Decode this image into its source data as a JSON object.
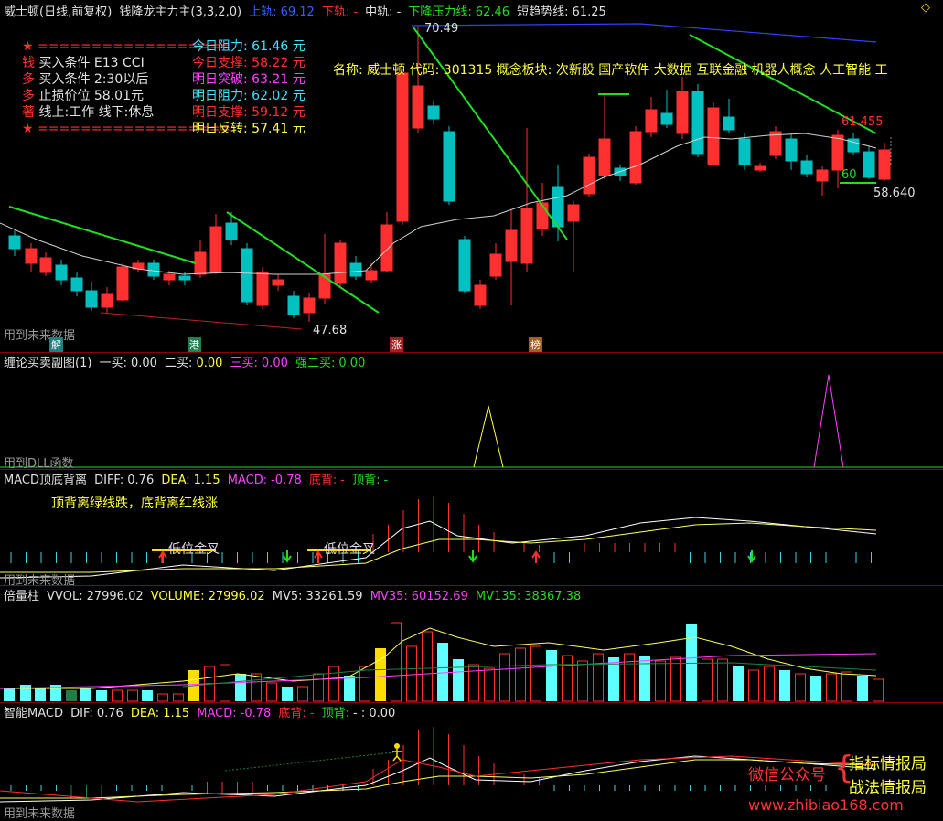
{
  "main": {
    "header": {
      "stock": "威士顿(日线,前复权)",
      "indicator": "钱降龙主力主(3,3,2,0)",
      "upper_label": "上轨:",
      "upper_value": "69.12",
      "lower_label": "下轨:",
      "lower_value": "-",
      "mid_label": "中轨:",
      "mid_value": "-",
      "pressure_label": "下降压力线:",
      "pressure_value": "62.46",
      "trend_label": "短趋势线:",
      "trend_value": "61.25"
    },
    "info_left": [
      {
        "mark": "★",
        "text": "=================="
      },
      {
        "mark": "钱",
        "text": "买入条件 E13 CCI"
      },
      {
        "mark": "多",
        "text": "买入条件 2:30以后"
      },
      {
        "mark": "多",
        "text": "止损价位 58.01元"
      },
      {
        "mark": "著",
        "text": "线上:工作 线下:休息"
      },
      {
        "mark": "★",
        "text": "=================="
      }
    ],
    "info_right": [
      {
        "label": "今日阻力:",
        "value": "61.46 元"
      },
      {
        "label": "今日支撑:",
        "value": "58.22 元"
      },
      {
        "label": "明日突破:",
        "value": "63.21 元"
      },
      {
        "label": "明日阻力:",
        "value": "62.02 元"
      },
      {
        "label": "明日支撑:",
        "value": "59.12 元"
      },
      {
        "label": "明日反转:",
        "value": "57.41 元"
      }
    ],
    "name_line": "名称: 威士顿 代码: 301315 概念板块: 次新股 国产软件 大数据 互联金融 机器人概念 人工智能 工",
    "high_label": "70.49",
    "low_label": "47.68",
    "price_label_1": "61.455",
    "price_label_2": "60",
    "price_label_3": "58.640",
    "future_note": "用到未来数据",
    "bottom_tags": [
      "解",
      "港",
      "涨",
      "榜"
    ]
  },
  "chanlun": {
    "title": "缠论买卖副图(1)",
    "buy1_label": "一买:",
    "buy1_value": "0.00",
    "buy2_label": "二买:",
    "buy2_value": "0.00",
    "buy3_label": "三买:",
    "buy3_value": "0.00",
    "strong2_label": "强二买:",
    "strong2_value": "0.00",
    "note": "用到DLL函数"
  },
  "macd_div": {
    "title": "MACD顶底背离",
    "diff_label": "DIFF:",
    "diff_value": "0.76",
    "dea_label": "DEA:",
    "dea_value": "1.15",
    "macd_label": "MACD:",
    "macd_value": "-0.78",
    "bottom_label": "底背:",
    "bottom_value": "-",
    "top_label": "顶背:",
    "top_value": "-",
    "subtitle": "顶背离绿线跌，底背离红线涨",
    "cross1": "低位金叉",
    "cross2": "低位金叉",
    "note": "用到未来数据"
  },
  "volume": {
    "title": "倍量柱",
    "vvol_label": "VVOL:",
    "vvol_value": "27996.02",
    "volume_label": "VOLUME:",
    "volume_value": "27996.02",
    "mv5_label": "MV5:",
    "mv5_value": "33261.59",
    "mv35_label": "MV35:",
    "mv35_value": "60152.69",
    "mv135_label": "MV135:",
    "mv135_value": "38367.38"
  },
  "smart_macd": {
    "title": "智能MACD",
    "dif_label": "DIF:",
    "dif_value": "0.76",
    "dea_label": "DEA:",
    "dea_value": "1.15",
    "macd_label": "MACD:",
    "macd_value": "-0.78",
    "bottom_label": "底背:",
    "bottom_value": "-",
    "top_label": "顶背:",
    "top_value": "- : 0.00",
    "note": "用到未来数据"
  },
  "watermark": {
    "wechat": "微信公众号",
    "line1": "指标情报局",
    "line2": "战法情报局",
    "url": "www.zhibiao168.com"
  },
  "colors": {
    "up": "#ff3030",
    "down": "#00c0c0",
    "background": "#000000",
    "separator": "#8b0000",
    "green_line": "#22dd22",
    "ma_line": "#d0d0d0",
    "volume_cyan": "#60ffff",
    "volume_yellow": "#ffdd00"
  }
}
